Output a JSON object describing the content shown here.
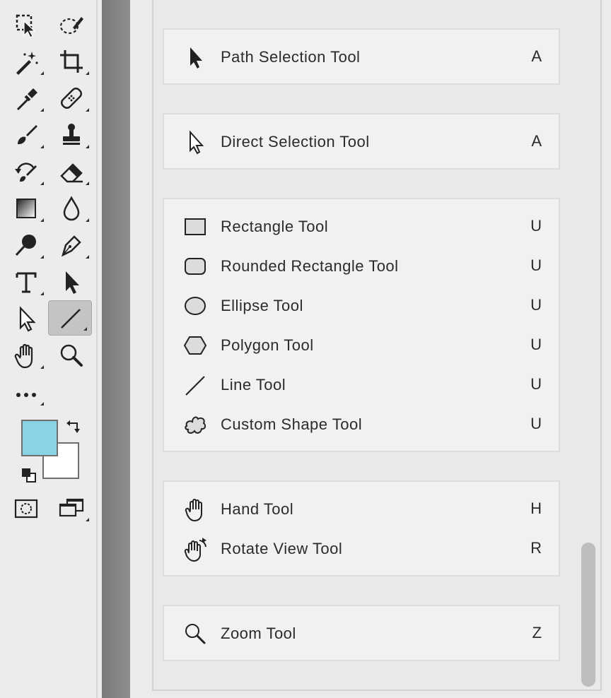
{
  "toolbar": {
    "tools": [
      {
        "name": "move-tool",
        "icon": "move-icon"
      },
      {
        "name": "lasso-tool",
        "icon": "lasso-icon"
      },
      {
        "name": "magic-wand-tool",
        "icon": "magic-wand-icon"
      },
      {
        "name": "crop-tool",
        "icon": "crop-icon"
      },
      {
        "name": "eyedropper-tool",
        "icon": "eyedropper-icon"
      },
      {
        "name": "healing-brush-tool",
        "icon": "bandage-icon"
      },
      {
        "name": "brush-tool",
        "icon": "brush-icon"
      },
      {
        "name": "stamp-tool",
        "icon": "stamp-icon"
      },
      {
        "name": "history-brush-tool",
        "icon": "history-brush-icon"
      },
      {
        "name": "eraser-tool",
        "icon": "eraser-icon"
      },
      {
        "name": "gradient-tool",
        "icon": "gradient-icon"
      },
      {
        "name": "blur-tool",
        "icon": "drop-icon"
      },
      {
        "name": "dodge-tool",
        "icon": "dodge-icon"
      },
      {
        "name": "pen-tool",
        "icon": "pen-icon"
      },
      {
        "name": "type-tool",
        "icon": "type-icon"
      },
      {
        "name": "path-selection-tool",
        "icon": "arrow-filled-icon"
      },
      {
        "name": "direct-selection-tool",
        "icon": "arrow-outline-icon"
      },
      {
        "name": "line-tool",
        "icon": "line-icon",
        "active": true
      },
      {
        "name": "hand-tool",
        "icon": "hand-icon"
      },
      {
        "name": "zoom-tool",
        "icon": "magnifier-icon"
      },
      {
        "name": "more-tools",
        "icon": "ellipsis-icon"
      }
    ],
    "colors": {
      "foreground": "#88d3e6",
      "background": "#ffffff"
    }
  },
  "menu": {
    "groups": [
      {
        "items": [
          {
            "label": "Path Selection Tool",
            "key": "A",
            "icon": "arrow-filled-icon"
          }
        ]
      },
      {
        "items": [
          {
            "label": "Direct Selection Tool",
            "key": "A",
            "icon": "arrow-outline-icon"
          }
        ]
      },
      {
        "items": [
          {
            "label": "Rectangle Tool",
            "key": "U",
            "icon": "rectangle-icon"
          },
          {
            "label": "Rounded Rectangle Tool",
            "key": "U",
            "icon": "rounded-rectangle-icon"
          },
          {
            "label": "Ellipse Tool",
            "key": "U",
            "icon": "ellipse-icon"
          },
          {
            "label": "Polygon Tool",
            "key": "U",
            "icon": "polygon-icon"
          },
          {
            "label": "Line Tool",
            "key": "U",
            "icon": "line-icon"
          },
          {
            "label": "Custom Shape Tool",
            "key": "U",
            "icon": "custom-shape-icon"
          }
        ]
      },
      {
        "items": [
          {
            "label": "Hand Tool",
            "key": "H",
            "icon": "hand-icon"
          },
          {
            "label": "Rotate View Tool",
            "key": "R",
            "icon": "rotate-view-icon"
          }
        ]
      },
      {
        "items": [
          {
            "label": "Zoom Tool",
            "key": "Z",
            "icon": "magnifier-icon"
          }
        ]
      }
    ]
  }
}
